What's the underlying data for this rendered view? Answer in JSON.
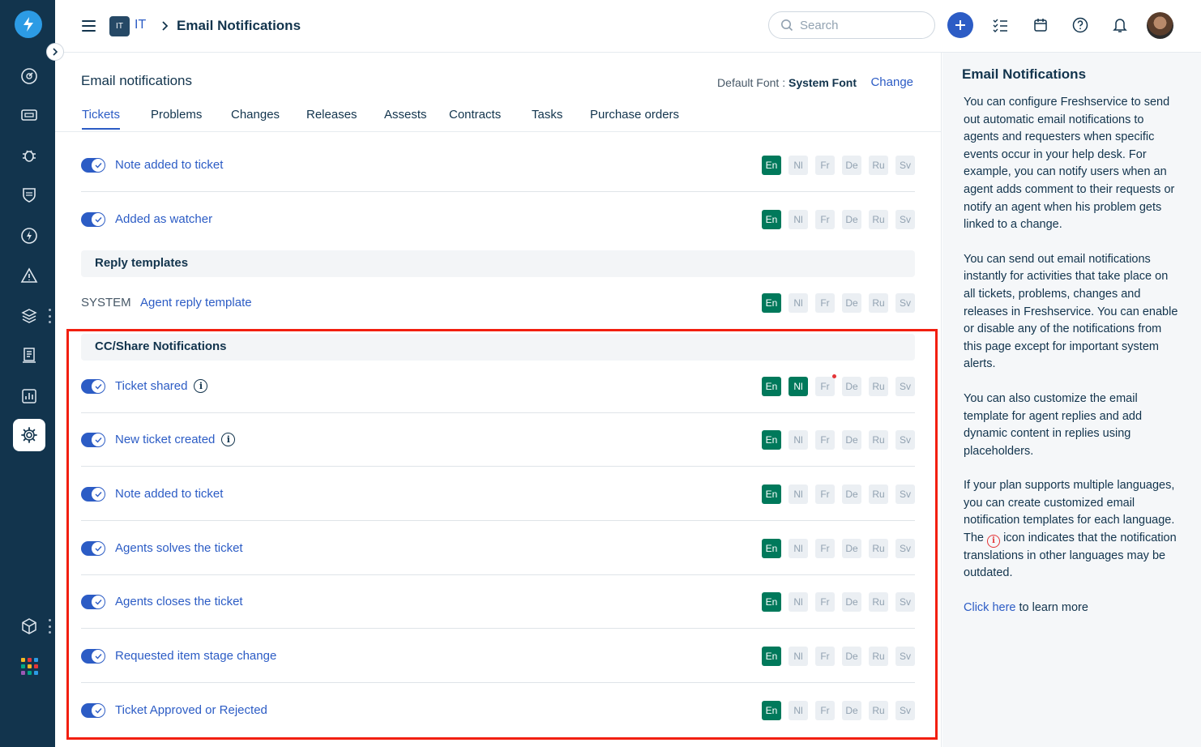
{
  "header": {
    "workspace_badge": "IT",
    "workspace_name": "IT",
    "breadcrumb_separator": ">",
    "page_title": "Email Notifications",
    "search_placeholder": "Search"
  },
  "main": {
    "title": "Email notifications",
    "default_font_label": "Default Font :",
    "default_font_value": "System Font",
    "change_label": "Change",
    "tabs": [
      "Tickets",
      "Problems",
      "Changes",
      "Releases",
      "Assests",
      "Contracts",
      "Tasks",
      "Purchase orders"
    ],
    "active_tab": "Tickets"
  },
  "languages": [
    "En",
    "Nl",
    "Fr",
    "De",
    "Ru",
    "Sv"
  ],
  "rows_top": [
    {
      "label": "Note added to ticket",
      "enabled": true,
      "active_langs": [
        "En"
      ]
    },
    {
      "label": "Added as watcher",
      "enabled": true,
      "active_langs": [
        "En"
      ]
    }
  ],
  "reply_templates": {
    "heading": "Reply templates",
    "system_tag": "SYSTEM",
    "label": "Agent reply template",
    "active_langs": [
      "En"
    ]
  },
  "cc_share": {
    "heading": "CC/Share Notifications",
    "rows": [
      {
        "label": "Ticket shared",
        "enabled": true,
        "info": true,
        "active_langs": [
          "En",
          "Nl"
        ],
        "outdated_dot": "Fr"
      },
      {
        "label": "New ticket created",
        "enabled": true,
        "info": true,
        "active_langs": [
          "En"
        ]
      },
      {
        "label": "Note added to ticket",
        "enabled": true,
        "info": false,
        "active_langs": [
          "En"
        ]
      },
      {
        "label": "Agents solves the ticket",
        "enabled": true,
        "info": false,
        "active_langs": [
          "En"
        ]
      },
      {
        "label": "Agents closes the ticket",
        "enabled": true,
        "info": false,
        "active_langs": [
          "En"
        ]
      },
      {
        "label": "Requested item stage change",
        "enabled": true,
        "info": false,
        "active_langs": [
          "En"
        ]
      },
      {
        "label": "Ticket Approved or Rejected",
        "enabled": true,
        "info": false,
        "active_langs": [
          "En"
        ]
      }
    ]
  },
  "help": {
    "title": "Email Notifications",
    "p1": "You can configure Freshservice to send out automatic email notifications to agents and requesters when specific events occur in your help desk. For example, you can notify users when an agent adds comment to their requests or notify an agent when his problem gets linked to a change.",
    "p2": "You can send out email notifications instantly for activities that take place on all tickets, problems, changes and releases in Freshservice. You can enable or disable any of the notifications from this page except for important system alerts.",
    "p3": "You can also customize the email template for agent replies and add dynamic content in replies using placeholders.",
    "p4_before": "If your plan supports multiple languages, you can create customized email notification templates for each language. The",
    "p4_after": "icon indicates that the notification translations in other languages may be outdated.",
    "click_here": "Click here",
    "learn_more": "to learn more"
  },
  "colors": {
    "rail": "#12344d",
    "accent": "#2c5cc5",
    "lang_active": "#00795b",
    "highlight": "#f21f10"
  }
}
